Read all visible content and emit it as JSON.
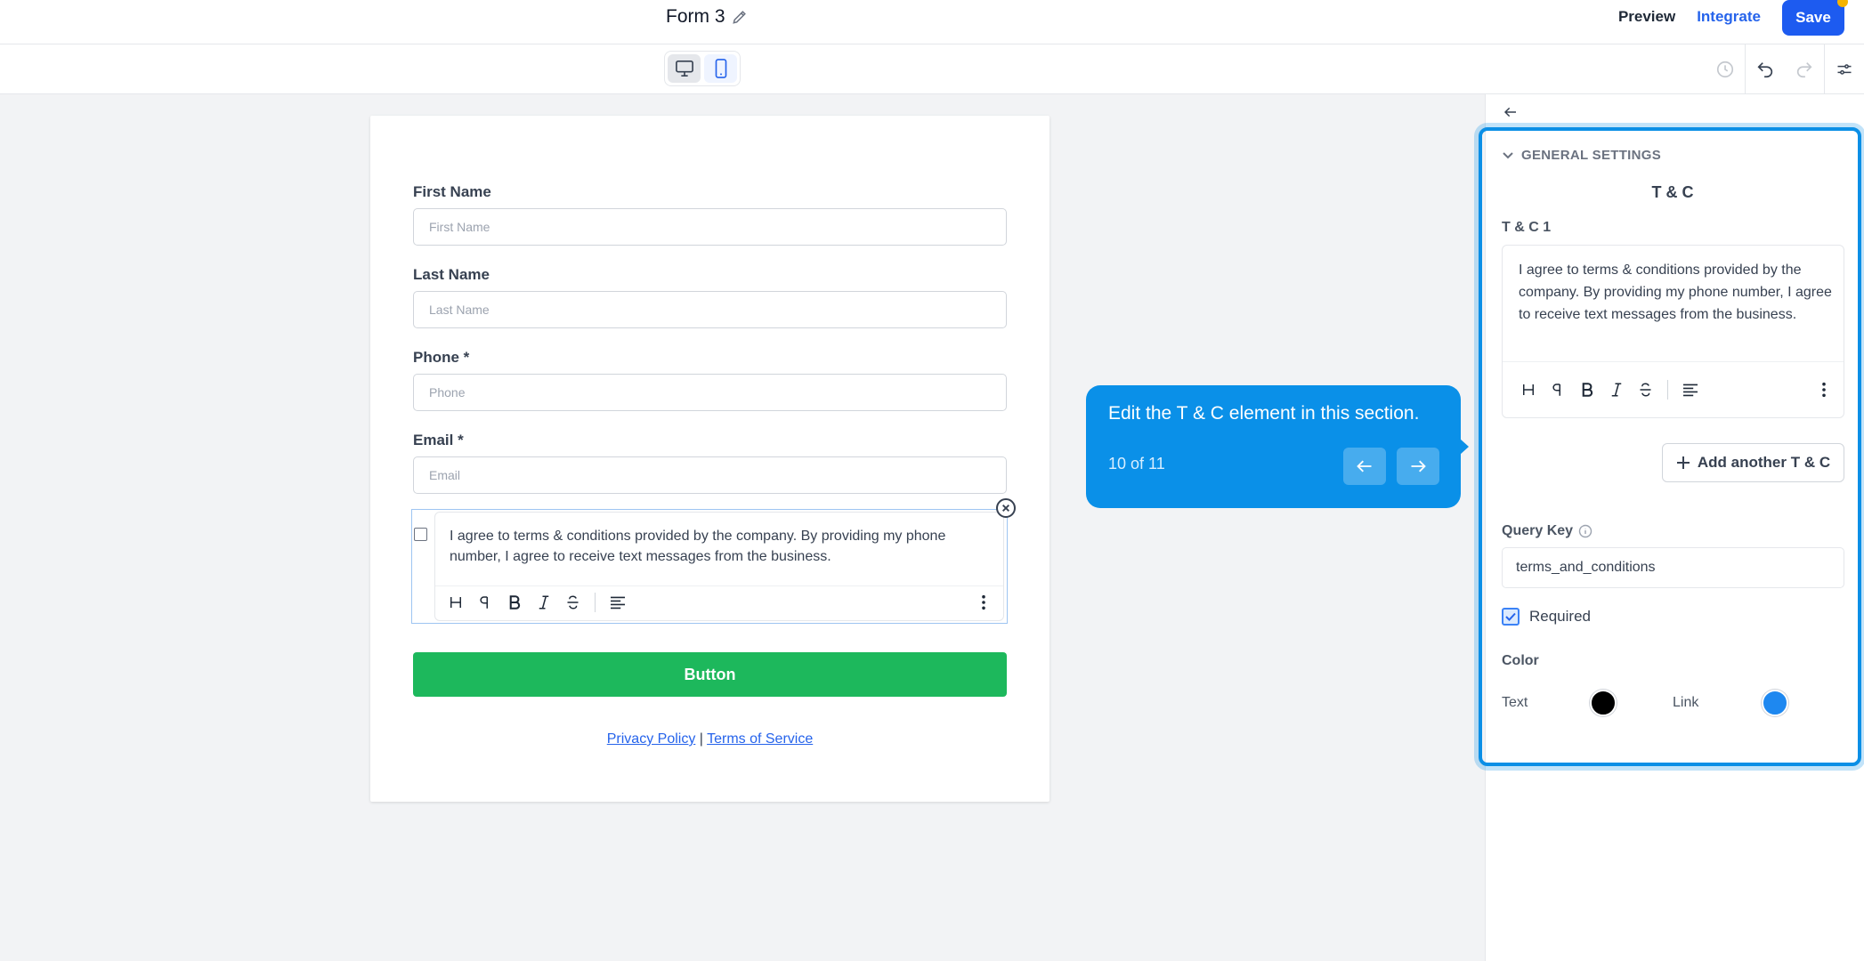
{
  "header": {
    "form_title": "Form 3",
    "preview_label": "Preview",
    "integrate_label": "Integrate",
    "save_label": "Save"
  },
  "form": {
    "fields": [
      {
        "label": "First Name",
        "placeholder": "First Name"
      },
      {
        "label": "Last Name",
        "placeholder": "Last Name"
      },
      {
        "label": "Phone *",
        "placeholder": "Phone"
      },
      {
        "label": "Email *",
        "placeholder": "Email"
      }
    ],
    "tc_text": "I agree to terms & conditions provided by the company. By providing my phone number, I agree to receive text messages from the business.",
    "button_label": "Button",
    "privacy_label": "Privacy Policy",
    "separator": "|",
    "terms_label": "Terms of Service",
    "button_color": "#1db85c"
  },
  "tour": {
    "message": "Edit the T & C element in this section.",
    "count": "10 of 11"
  },
  "panel": {
    "section_label": "GENERAL SETTINGS",
    "title": "T & C",
    "tc1_label": "T & C 1",
    "tc1_text": "I agree to terms & conditions provided by the company. By providing my phone number, I agree to receive text messages from the business.",
    "add_label": "Add another T & C",
    "query_key_label": "Query Key",
    "query_key_value": "terms_and_conditions",
    "required_label": "Required",
    "required_checked": true,
    "color_label": "Color",
    "text_color_label": "Text",
    "text_color": "#000000",
    "link_color_label": "Link",
    "link_color": "#1e88f0"
  },
  "accent": "#1d5bf0"
}
